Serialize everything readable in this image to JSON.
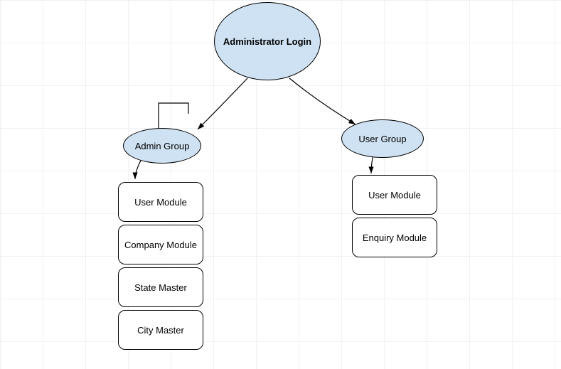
{
  "diagram": {
    "type": "flow",
    "root": {
      "label": "Administrator Login"
    },
    "adminGroup": {
      "label": "Admin Group",
      "modules": [
        {
          "label": "User Module"
        },
        {
          "label": "Company Module"
        },
        {
          "label": "State Master"
        },
        {
          "label": "City Master"
        }
      ]
    },
    "userGroup": {
      "label": "User Group",
      "modules": [
        {
          "label": "User Module"
        },
        {
          "label": "Enquiry Module"
        }
      ]
    }
  }
}
